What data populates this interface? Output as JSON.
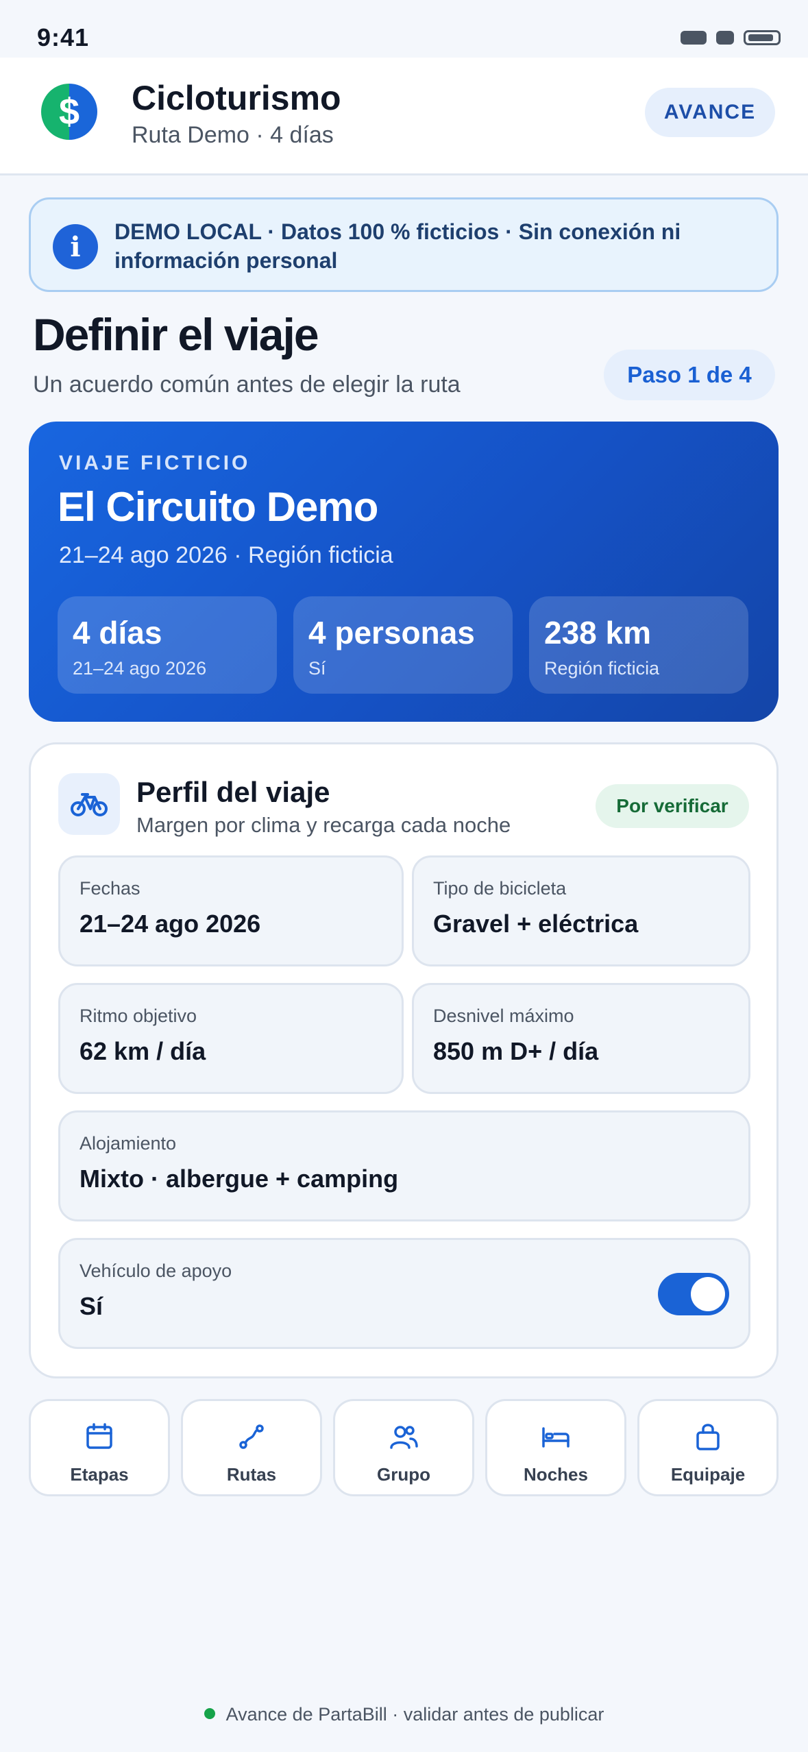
{
  "status": {
    "time": "9:41"
  },
  "header": {
    "logo_glyph": "$",
    "title": "Cicloturismo",
    "subtitle": "Ruta Demo · 4 días",
    "action_label": "AVANCE"
  },
  "banner": {
    "icon": "i",
    "text": "DEMO LOCAL · Datos 100 % ficticios · Sin conexión ni información personal"
  },
  "page": {
    "title": "Definir el viaje",
    "subtitle": "Un acuerdo común antes de elegir la ruta",
    "step": "Paso 1 de 4"
  },
  "trip": {
    "kicker": "VIAJE FICTICIO",
    "name": "El Circuito Demo",
    "dates_region": "21–24 ago 2026 · Región ficticia",
    "stats": [
      {
        "value": "4 días",
        "label": "21–24 ago 2026"
      },
      {
        "value": "4 personas",
        "label": "Sí"
      },
      {
        "value": "238 km",
        "label": "Región ficticia"
      }
    ]
  },
  "profile": {
    "title": "Perfil del viaje",
    "subtitle": "Margen por clima y recarga cada noche",
    "badge": "Por verificar",
    "fields": [
      {
        "label": "Fechas",
        "value": "21–24 ago 2026"
      },
      {
        "label": "Tipo de bicicleta",
        "value": "Gravel + eléctrica"
      },
      {
        "label": "Ritmo objetivo",
        "value": "62 km / día"
      },
      {
        "label": "Desnivel máximo",
        "value": "850 m D+ / día"
      },
      {
        "label": "Alojamiento",
        "value": "Mixto · albergue + camping"
      },
      {
        "label": "Vehículo de apoyo",
        "value": "Sí",
        "toggle_on": true
      }
    ]
  },
  "nav": [
    {
      "label": "Etapas",
      "icon": "calendar-icon"
    },
    {
      "label": "Rutas",
      "icon": "route-icon"
    },
    {
      "label": "Grupo",
      "icon": "group-icon"
    },
    {
      "label": "Noches",
      "icon": "bed-icon"
    },
    {
      "label": "Equipaje",
      "icon": "bag-icon"
    }
  ],
  "footer": {
    "text": "Avance de PartaBill · validar antes de publicar"
  },
  "colors": {
    "accent": "#1a63d6",
    "success": "#16a34a",
    "card_gradient": "#1552c6"
  }
}
